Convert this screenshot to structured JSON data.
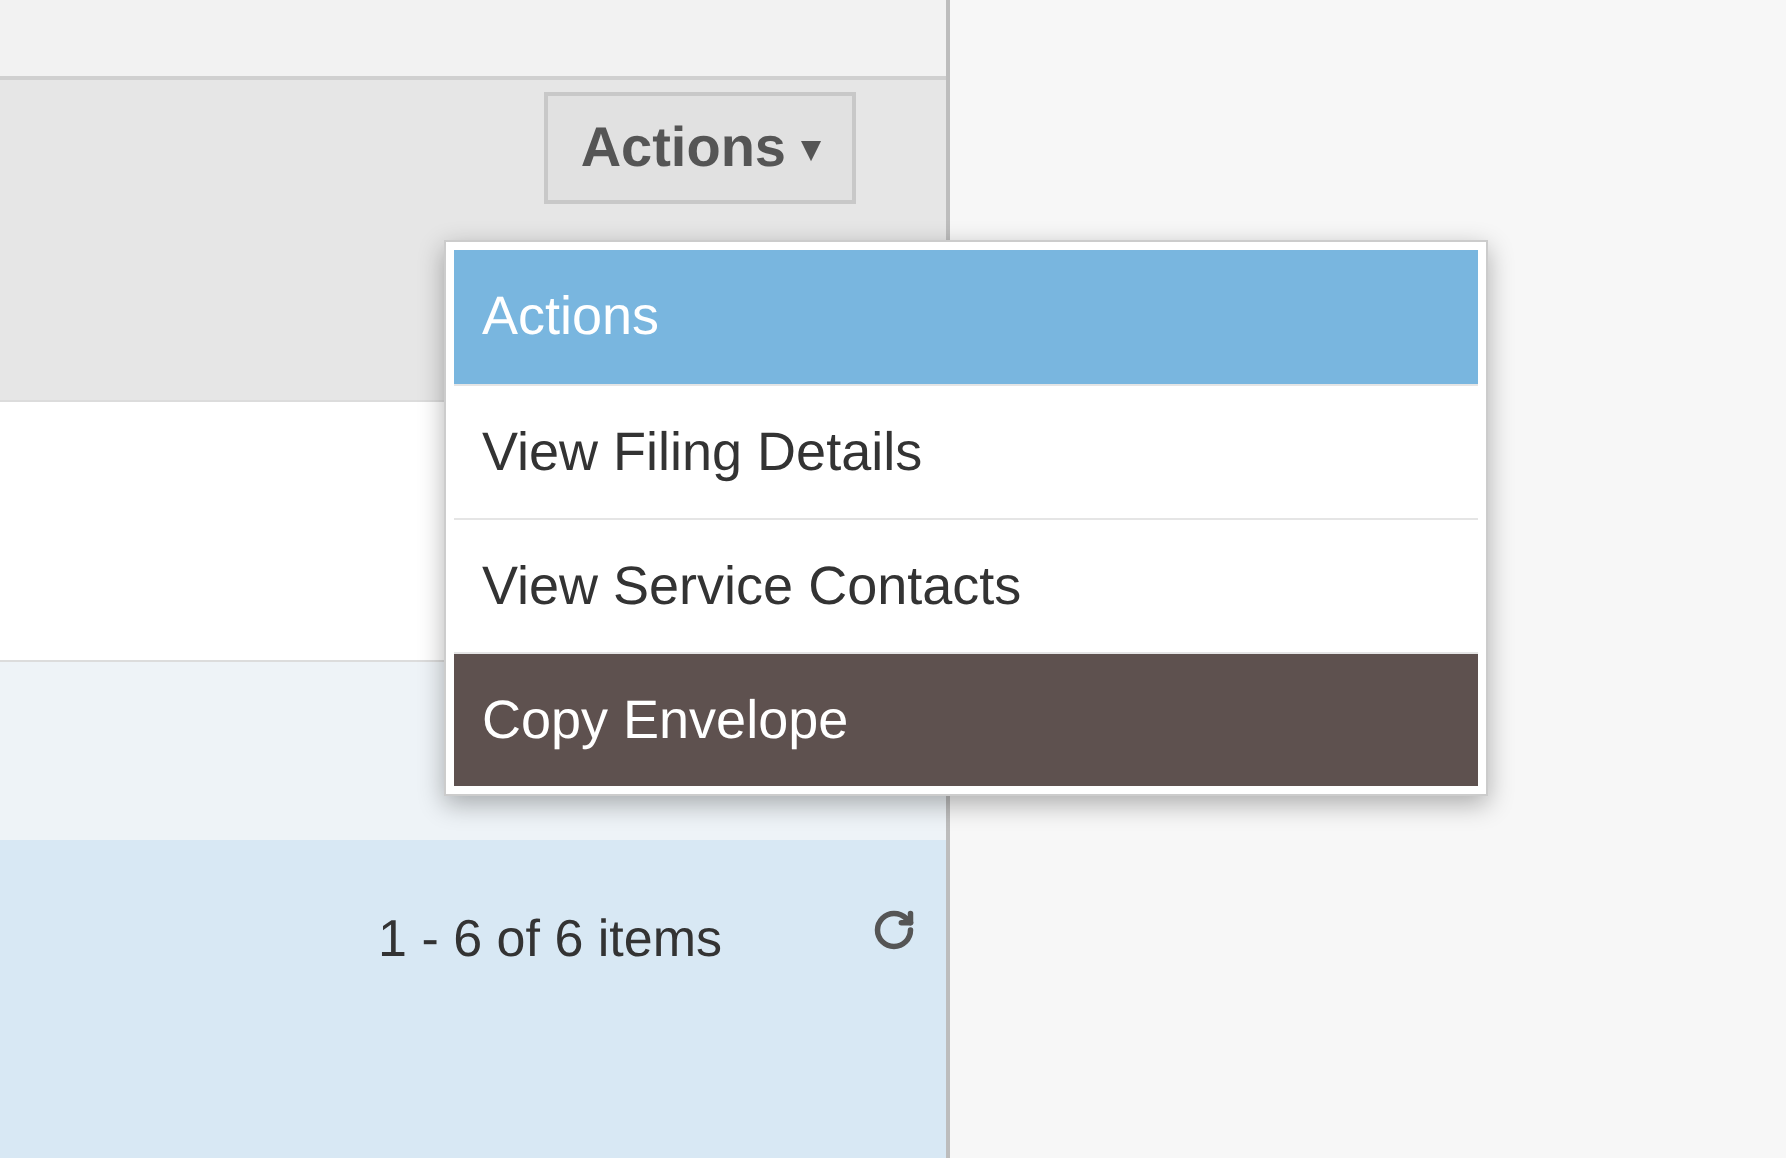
{
  "actions_button": {
    "label": "Actions",
    "caret": "▾"
  },
  "actions_menu": {
    "items": [
      {
        "kind": "header",
        "label": "Actions"
      },
      {
        "kind": "option",
        "label": "View Filing Details",
        "highlighted": false
      },
      {
        "kind": "option",
        "label": "View Service Contacts",
        "highlighted": false
      },
      {
        "kind": "option",
        "label": "Copy Envelope",
        "highlighted": true
      }
    ]
  },
  "pager": {
    "summary": "1 - 6 of 6 items"
  }
}
